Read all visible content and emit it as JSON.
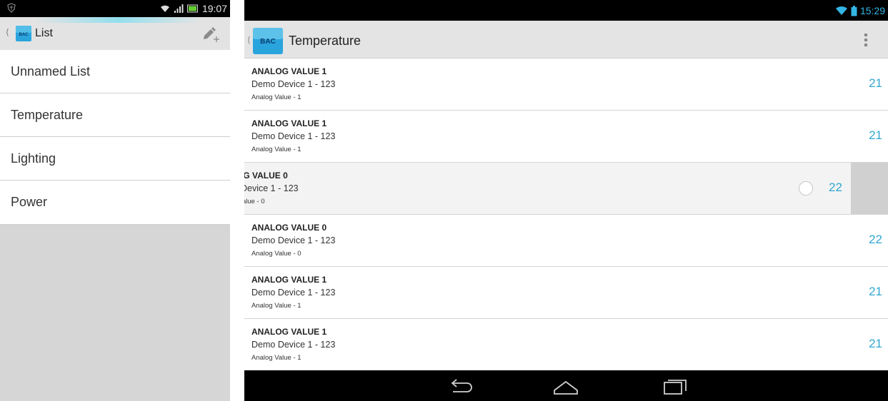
{
  "phone": {
    "status_time": "19:07",
    "app_icon_text": "BAC",
    "title": "List",
    "lists": [
      "Unnamed List",
      "Temperature",
      "Lighting",
      "Power"
    ]
  },
  "tablet": {
    "status_time": "15:29",
    "app_icon_text": "BAC",
    "title": "Temperature",
    "points": [
      {
        "name": "ANALOG VALUE 1",
        "device": "Demo Device 1 - 123",
        "object": "Analog Value - 1",
        "value": "21"
      },
      {
        "name": "ANALOG VALUE 1",
        "device": "Demo Device 1 - 123",
        "object": "Analog Value - 1",
        "value": "21"
      },
      {
        "name": "ıG VALUE 0",
        "device": "Device 1 - 123",
        "object": "'alue - 0",
        "value": "22"
      },
      {
        "name": "ANALOG VALUE 0",
        "device": "Demo Device 1 - 123",
        "object": "Analog Value - 0",
        "value": "22"
      },
      {
        "name": "ANALOG VALUE 1",
        "device": "Demo Device 1 - 123",
        "object": "Analog Value - 1",
        "value": "21"
      },
      {
        "name": "ANALOG VALUE 1",
        "device": "Demo Device 1 - 123",
        "object": "Analog Value - 1",
        "value": "21"
      }
    ]
  },
  "colors": {
    "accent": "#33b5e5",
    "value_text": "#33a7d0",
    "action_bar": "#e4e4e4",
    "status_bar": "#000000",
    "phone_background": "#d6d6d6"
  },
  "icons": {
    "phone_status_left": "shield-icon",
    "status_right": [
      "wifi-icon",
      "signal-icon",
      "battery-icon"
    ],
    "phone_action": "add-pencil-icon",
    "tablet_action": "overflow-menu-icon",
    "nav": [
      "back-icon",
      "home-icon",
      "recent-apps-icon"
    ]
  }
}
